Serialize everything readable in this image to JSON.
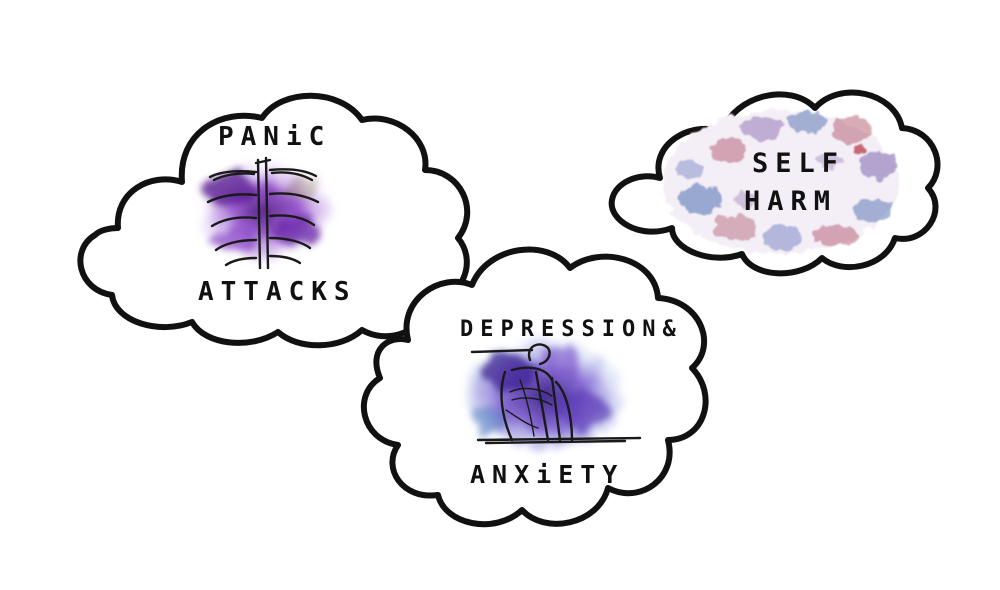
{
  "clouds": [
    {
      "id": "panic-attacks",
      "text_top": "PANiC",
      "text_bottom": "ATTACKS",
      "icon": "ribcage-icon",
      "accent": "#7a2fb5"
    },
    {
      "id": "self-harm",
      "text_top": "SELF",
      "text_bottom": "HARM",
      "icon": "watercolor-pattern",
      "accent_blue": "#4f6fb0",
      "accent_red": "#a8485f"
    },
    {
      "id": "depression-anxiety",
      "text_top": "DEPRESSION&",
      "text_bottom": "ANXiETY",
      "icon": "sitting-figure-icon",
      "accent": "#6c3ab8"
    }
  ],
  "colors": {
    "background": "#ffffff",
    "outline": "#111111",
    "purple": "#7a2fb5",
    "blue": "#4f6fb0",
    "magenta": "#a8485f"
  }
}
